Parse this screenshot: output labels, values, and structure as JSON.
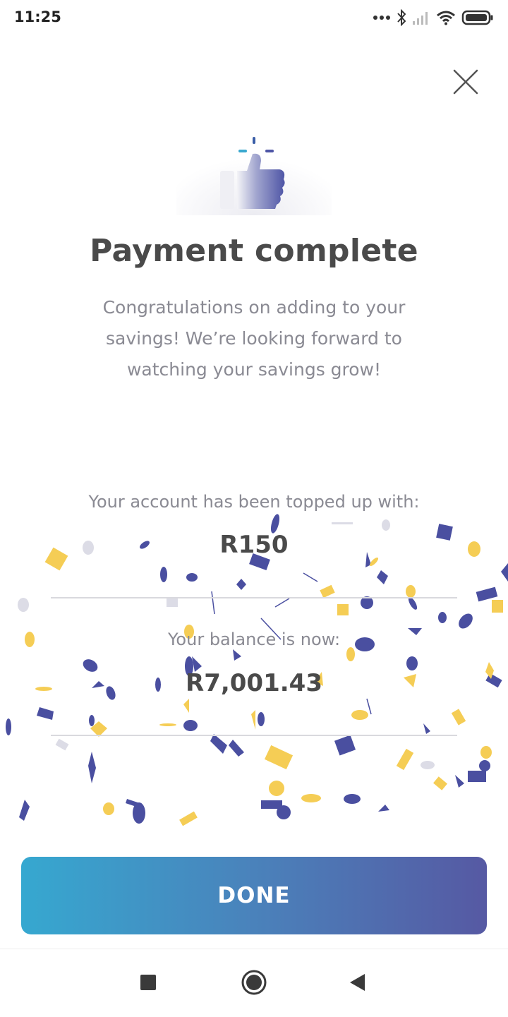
{
  "status_bar": {
    "time": "11:25",
    "icons": [
      "more-dots-icon",
      "bluetooth-icon",
      "signal-icon",
      "wifi-icon",
      "battery-icon"
    ]
  },
  "dialog": {
    "close_icon": "close-icon",
    "hero_icon": "thumbs-up-icon",
    "title": "Payment complete",
    "message": "Congratulations on adding to your savings! We’re looking forward to watching your savings grow!",
    "topped_up_label": "Your account has been topped up with:",
    "topped_up_amount": "R150",
    "balance_label": "Your balance is now:",
    "balance_amount": "R7,001.43",
    "done_label": "DONE"
  },
  "colors": {
    "confetti_blue": "#4a4fa0",
    "confetti_yellow": "#f5cd55",
    "button_gradient_start": "#36a8d0",
    "button_gradient_end": "#5659a3",
    "title_text": "#4a4a4a",
    "body_text": "#8a8a93"
  },
  "nav_bar": {
    "buttons": [
      "recents-square-icon",
      "home-circle-icon",
      "back-triangle-icon"
    ]
  }
}
